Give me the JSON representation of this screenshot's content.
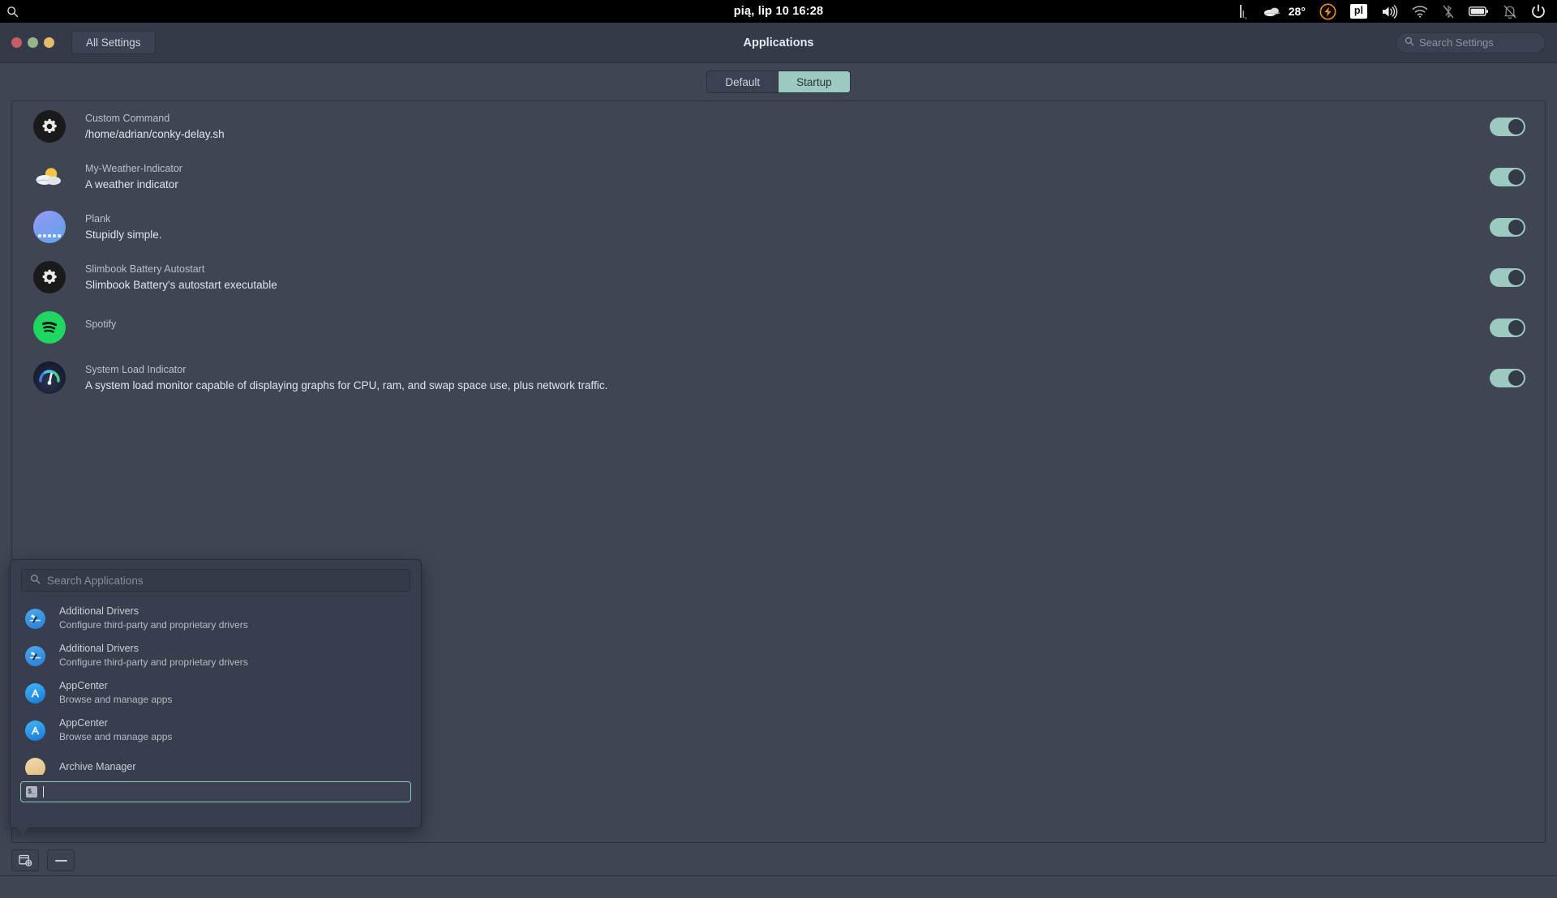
{
  "panel": {
    "search_icon": "search-icon",
    "clock": "pią, lip 10   16:28",
    "indicators": {
      "system_load": "system-load-graph-icon",
      "weather_icon": "weather-cloud-icon",
      "temperature": "28°",
      "slimbook_battery": "lightning-bolt-icon",
      "keyboard_layout": "pl",
      "volume": "volume-icon",
      "network": "wifi-icon",
      "bluetooth": "bluetooth-disabled-icon",
      "battery": "battery-icon",
      "notifications": "notifications-muted-icon",
      "session": "power-icon"
    }
  },
  "header": {
    "all_settings_label": "All Settings",
    "title": "Applications",
    "search_placeholder": "Search Settings",
    "search_value": ""
  },
  "tabs": [
    {
      "label": "Default",
      "active": false
    },
    {
      "label": "Startup",
      "active": true
    }
  ],
  "startup_apps": [
    {
      "icon": "gear-icon",
      "name": "Custom Command",
      "description": "/home/adrian/conky-delay.sh",
      "enabled": true
    },
    {
      "icon": "weather-icon",
      "name": "My-Weather-Indicator",
      "description": "A weather indicator",
      "enabled": true
    },
    {
      "icon": "plank-icon",
      "name": "Plank",
      "description": "Stupidly simple.",
      "enabled": true
    },
    {
      "icon": "gear-icon",
      "name": "Slimbook Battery Autostart",
      "description": "Slimbook Battery's autostart executable",
      "enabled": true
    },
    {
      "icon": "spotify-icon",
      "name": "Spotify",
      "description": "",
      "enabled": true
    },
    {
      "icon": "gauge-icon",
      "name": "System Load Indicator",
      "description": "A system load monitor capable of displaying graphs for CPU, ram, and swap space use, plus network traffic.",
      "enabled": true
    }
  ],
  "popover": {
    "search_placeholder": "Search Applications",
    "search_value": "",
    "results": [
      {
        "icon": "drivers-icon",
        "name": "Additional Drivers",
        "description": "Configure third-party and proprietary drivers"
      },
      {
        "icon": "drivers-icon",
        "name": "Additional Drivers",
        "description": "Configure third-party and proprietary drivers"
      },
      {
        "icon": "appcenter-icon",
        "name": "AppCenter",
        "description": "Browse and manage apps"
      },
      {
        "icon": "appcenter-icon",
        "name": "AppCenter",
        "description": "Browse and manage apps"
      },
      {
        "icon": "archive-icon",
        "name": "Archive Manager",
        "description": ""
      }
    ],
    "command_entry": {
      "icon": "terminal-icon",
      "icon_label": "$_",
      "value": "",
      "focused": true
    }
  },
  "toolbar": {
    "add_label": "add-startup-app",
    "remove_label": "remove-startup-app"
  },
  "colors": {
    "background": "#3f4553",
    "headerbar": "#353a49",
    "accent": "#9cc9c0",
    "panel": "#000000",
    "border": "#2b303d",
    "spotify_green": "#1ed760",
    "bolt_orange": "#f08b1d"
  }
}
